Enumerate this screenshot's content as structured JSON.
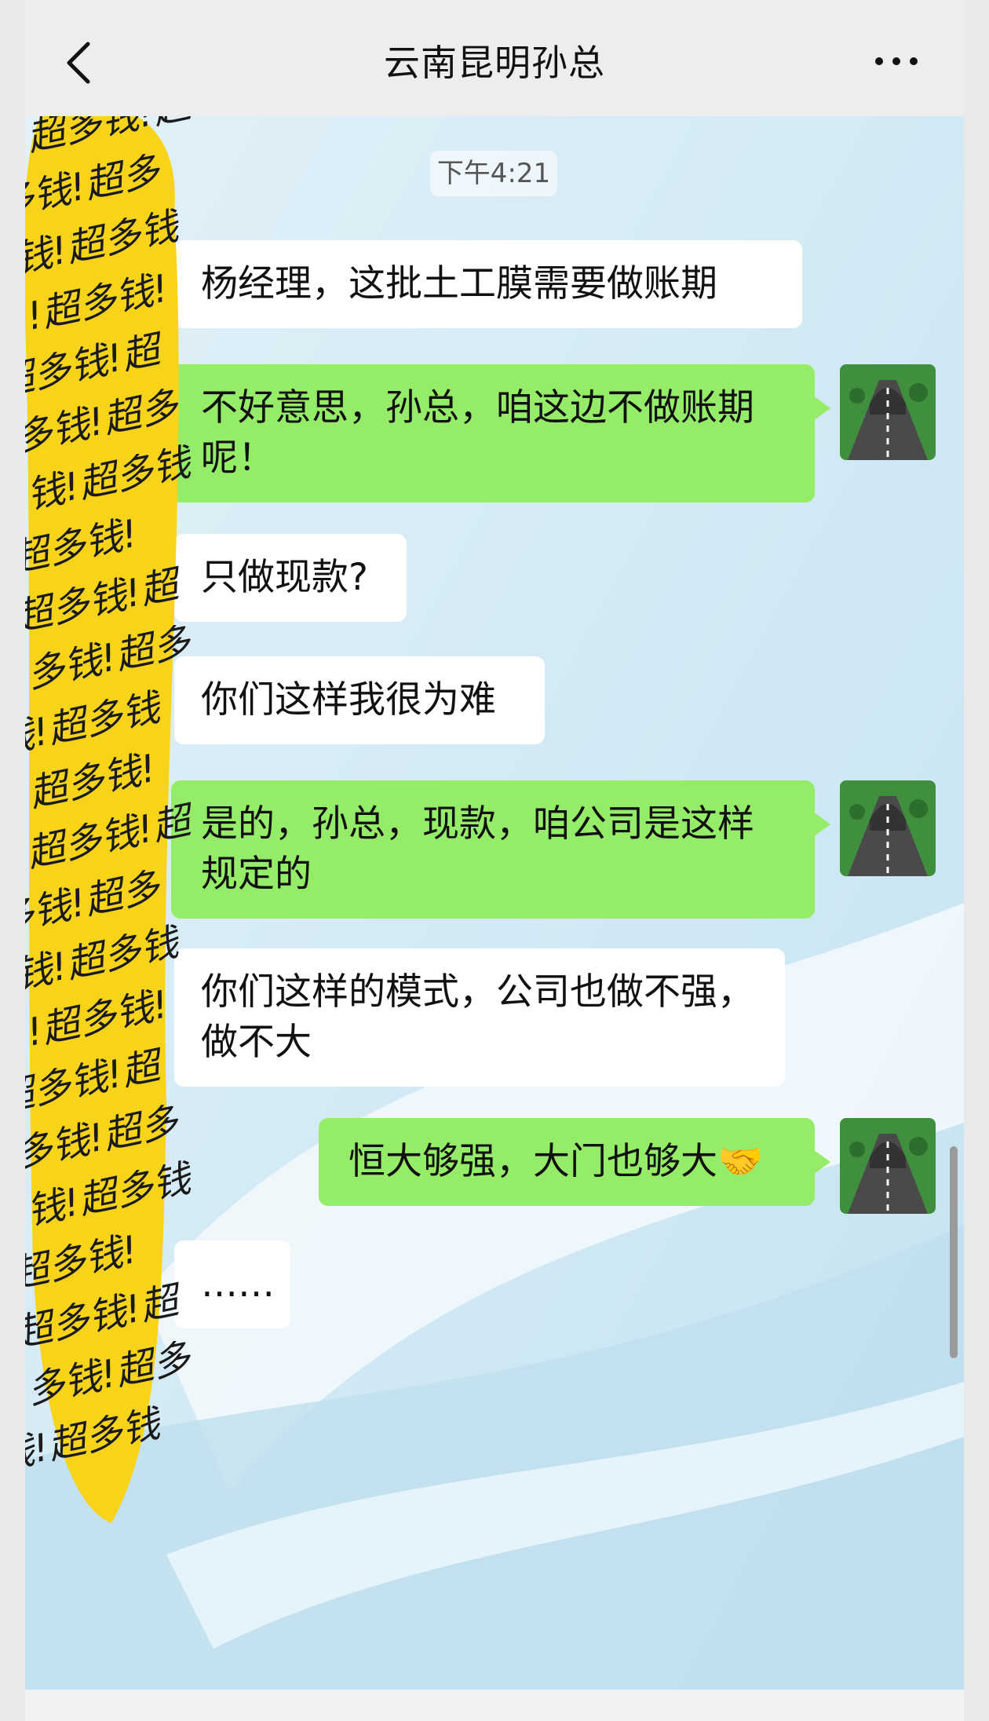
{
  "header": {
    "title": "云南昆明孙总",
    "back_icon": "chevron-left-icon",
    "more_icon": "more-dots-icon"
  },
  "time_label": "下午4:21",
  "messages": [
    {
      "side": "left",
      "text": "杨经理，这批土工膜需要做账期"
    },
    {
      "side": "right",
      "text": "不好意思，孙总，咱这边不做账期呢！"
    },
    {
      "side": "left",
      "text": "只做现款?"
    },
    {
      "side": "left",
      "text": "你们这样我很为难"
    },
    {
      "side": "right",
      "text": "是的，孙总，现款，咱公司是这样规定的"
    },
    {
      "side": "left",
      "text": "你们这样的模式，公司也做不强，做不大"
    },
    {
      "side": "right",
      "text": "恒大够强，大门也够大🤝"
    },
    {
      "side": "left",
      "text": "……"
    }
  ],
  "sticker": {
    "text": "超多钱!",
    "color": "#f7d31a"
  },
  "colors": {
    "bubble_right": "#95ec69",
    "bubble_left": "#ffffff",
    "header_bg": "#ededed"
  }
}
